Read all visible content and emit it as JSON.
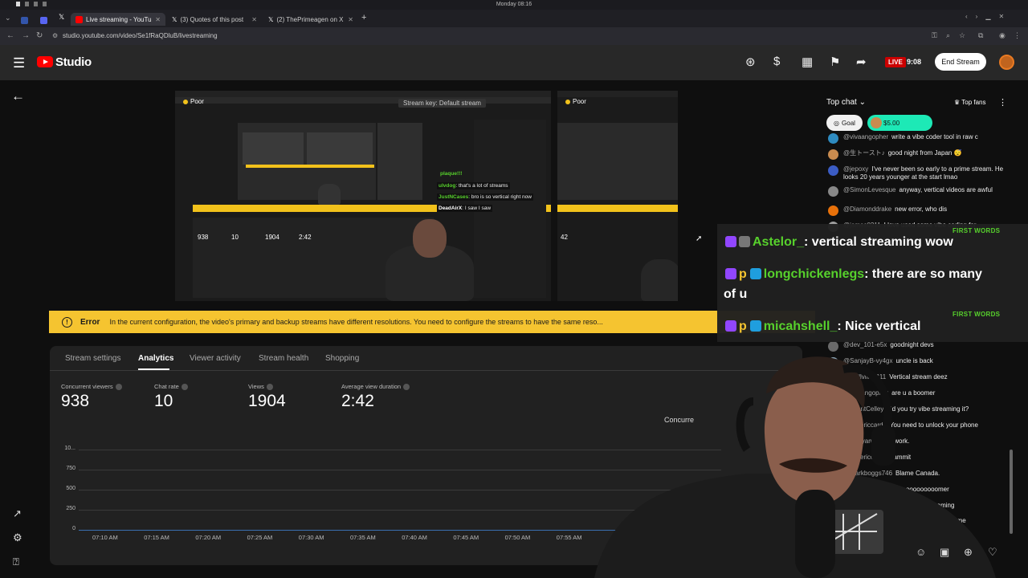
{
  "os": {
    "clock": "Monday 08:16"
  },
  "browser": {
    "tabs": [
      {
        "label": "Live streaming - YouTu",
        "active": true
      },
      {
        "label": "(3) Quotes of this post",
        "active": false
      },
      {
        "label": "(2) ThePrimeagen on X",
        "active": false
      }
    ],
    "url": "studio.youtube.com/video/Se1fRaQDluB/livestreaming"
  },
  "header": {
    "logo_text": "Studio",
    "live_badge": "LIVE",
    "live_time": "9:08",
    "end_stream": "End Stream"
  },
  "preview": {
    "poor_label": "Poor",
    "stream_key": "Stream key: Default stream",
    "inner_stats": [
      "938",
      "10",
      "1904",
      "2:42"
    ],
    "inner_stat_right": "42",
    "inner_chat": [
      {
        "name": "plaque!!!",
        "text": ""
      },
      {
        "name": "ulvdog",
        "text": "that's a lot of streams"
      },
      {
        "name": "JustNCases",
        "text": "bro is so vertical right now"
      },
      {
        "name": "DeadAirX",
        "text": "I saw I saw"
      }
    ]
  },
  "error": {
    "label": "Error",
    "message": "In the current configuration, the video's primary and backup streams have different resolutions. You need to configure the streams to have the same reso..."
  },
  "tabs": [
    "Stream settings",
    "Analytics",
    "Viewer activity",
    "Stream health",
    "Shopping"
  ],
  "metrics": [
    {
      "label": "Concurrent viewers",
      "value": "938"
    },
    {
      "label": "Chat rate",
      "value": "10"
    },
    {
      "label": "Views",
      "value": "1904"
    },
    {
      "label": "Average view duration",
      "value": "2:42"
    }
  ],
  "chart_label": "Concurre",
  "chart_data": {
    "type": "line",
    "yticks": [
      "10...",
      "750",
      "500",
      "250",
      "0"
    ],
    "xticks": [
      "07:10 AM",
      "07:15 AM",
      "07:20 AM",
      "07:25 AM",
      "07:30 AM",
      "07:35 AM",
      "07:40 AM",
      "07:45 AM",
      "07:50 AM",
      "07:55 AM"
    ]
  },
  "chat": {
    "title": "Top chat",
    "top_fans": "Top fans",
    "goal": "Goal",
    "super_amount": "$5.00",
    "messages_top": [
      {
        "author": "@vivaangopher",
        "text": "write a vibe coder tool in raw c",
        "color": "#2e8bc0"
      },
      {
        "author": "@生トースト♪",
        "text": "good night from Japan 😴",
        "color": "#c98b4f"
      },
      {
        "author": "@jepoxy",
        "text": "I've never been so early to a prime stream. He looks 20 years younger at the start lmao",
        "color": "#3b5cc4"
      },
      {
        "author": "@SimonLevesque",
        "text": "anyway, vertical videos are awful",
        "color": "#888"
      },
      {
        "author": "@Diamonddrake",
        "text": "new error, who dis",
        "color": "#e8710a"
      },
      {
        "author": "@james0211",
        "text": "I love used some vibe coding for",
        "color": "#9e9e9e"
      }
    ],
    "messages_bottom": [
      {
        "author": "@dev_101-e5x",
        "text": "goodnight devs",
        "color": "#6a6a6a"
      },
      {
        "author": "@SanjayB-vy4gx",
        "text": "uncle is back",
        "color": "#8aa4b5"
      },
      {
        "author": "@thrillvilled111",
        "text": "Vertical stream deez",
        "color": "#4caf50"
      },
      {
        "author": "@vivaangopher",
        "text": "are u a boomer",
        "color": "#2e8bc0"
      },
      {
        "author": "@GrantCelley",
        "text": "did you try vibe streaming it?",
        "color": "#e8710a"
      },
      {
        "author": "@codericcardo",
        "text": "You need to unlock your phone",
        "color": "#888"
      },
      {
        "author": "@setkyarwalar",
        "text": "it work.",
        "color": "#999"
      },
      {
        "author": "@codericcardo",
        "text": "dammit",
        "color": "#888"
      },
      {
        "author": "@markboggs746",
        "text": "Blame Canada.",
        "color": "#c44"
      },
      {
        "author": "@vivaangopher",
        "text": "boooooooooooomer",
        "color": "#2e8bc0"
      },
      {
        "author": "@blodeinformatica",
        "text": "diagonal streaming",
        "color": "#4caf50"
      },
      {
        "author": "@jacob",
        "text": "heyy how are you doing? first time",
        "color": "#777"
      }
    ]
  },
  "overlay": {
    "first_words": "FIRST WORDS",
    "lines": [
      {
        "name": "Astelor_",
        "text": ": vertical streaming wow"
      },
      {
        "name": "longchickenlegs",
        "text": ": there are so many"
      },
      {
        "name": "",
        "text": "of u"
      },
      {
        "name": "micahshell_",
        "text": ": Nice vertical"
      }
    ]
  }
}
